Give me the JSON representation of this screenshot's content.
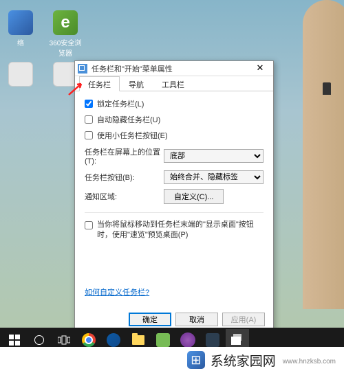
{
  "desktop": {
    "icons": [
      {
        "label": "络"
      },
      {
        "label": "360安全浏览器"
      },
      {
        "label": ""
      },
      {
        "label": ""
      }
    ]
  },
  "dialog": {
    "title": "任务栏和\"开始\"菜单属性",
    "tabs": [
      {
        "label": "任务栏",
        "active": true
      },
      {
        "label": "导航",
        "active": false
      },
      {
        "label": "工具栏",
        "active": false
      }
    ],
    "checkboxes": [
      {
        "label": "锁定任务栏(L)",
        "checked": true
      },
      {
        "label": "自动隐藏任务栏(U)",
        "checked": false
      },
      {
        "label": "使用小任务栏按钮(E)",
        "checked": false
      }
    ],
    "position": {
      "label": "任务栏在屏幕上的位置(T):",
      "value": "底部"
    },
    "buttons_combo": {
      "label": "任务栏按钮(B):",
      "value": "始终合并、隐藏标签"
    },
    "notification": {
      "label": "通知区域:",
      "button": "自定义(C)..."
    },
    "peek": {
      "label": "当你将鼠标移动到任务栏末端的\"显示桌面\"按钮时，使用\"速览\"预览桌面(P)",
      "checked": false
    },
    "link": "如何自定义任务栏?",
    "ok": "确定",
    "cancel": "取消",
    "apply": "应用(A)"
  },
  "watermark": {
    "brand": "系统家园网",
    "url": "www.hnzksb.com"
  }
}
